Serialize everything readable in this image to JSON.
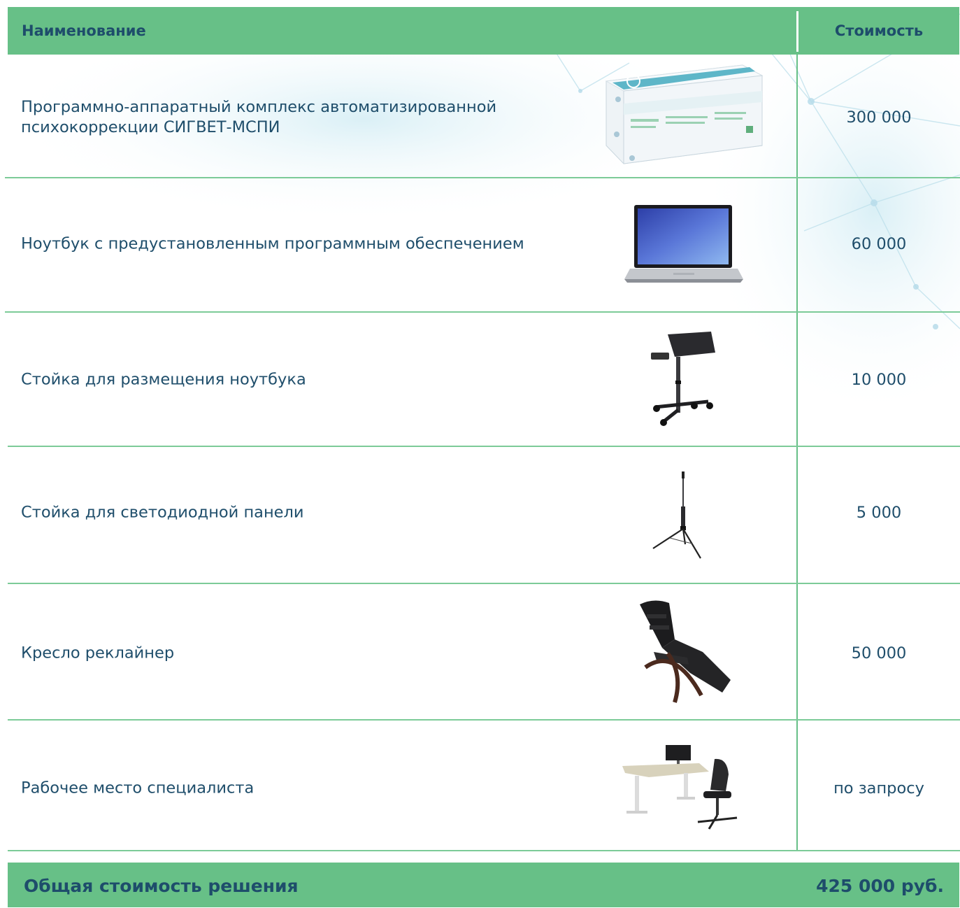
{
  "header": {
    "name_label": "Наименование",
    "cost_label": "Стоимость"
  },
  "rows": [
    {
      "name": "Программно-аппаратный комплекс автоматизированной психокоррекции СИГВЕТ-МСПИ",
      "cost": "300 000",
      "image": "software-box"
    },
    {
      "name": "Ноутбук с предустановленным программным обеспечением",
      "cost": "60 000",
      "image": "laptop"
    },
    {
      "name": "Стойка для размещения ноутбука",
      "cost": "10 000",
      "image": "laptop-stand"
    },
    {
      "name": "Стойка для светодиодной панели",
      "cost": "5 000",
      "image": "tripod-stand"
    },
    {
      "name": "Кресло реклайнер",
      "cost": "50 000",
      "image": "recliner-chair"
    },
    {
      "name": "Рабочее место специалиста",
      "cost": "по запросу",
      "image": "workstation"
    }
  ],
  "footer": {
    "total_label": "Общая стоимость решения",
    "total_value": "425 000 руб."
  },
  "colors": {
    "accent_green": "#67c087",
    "text_blue": "#1f4e6b",
    "line_green": "#7ccb98"
  }
}
